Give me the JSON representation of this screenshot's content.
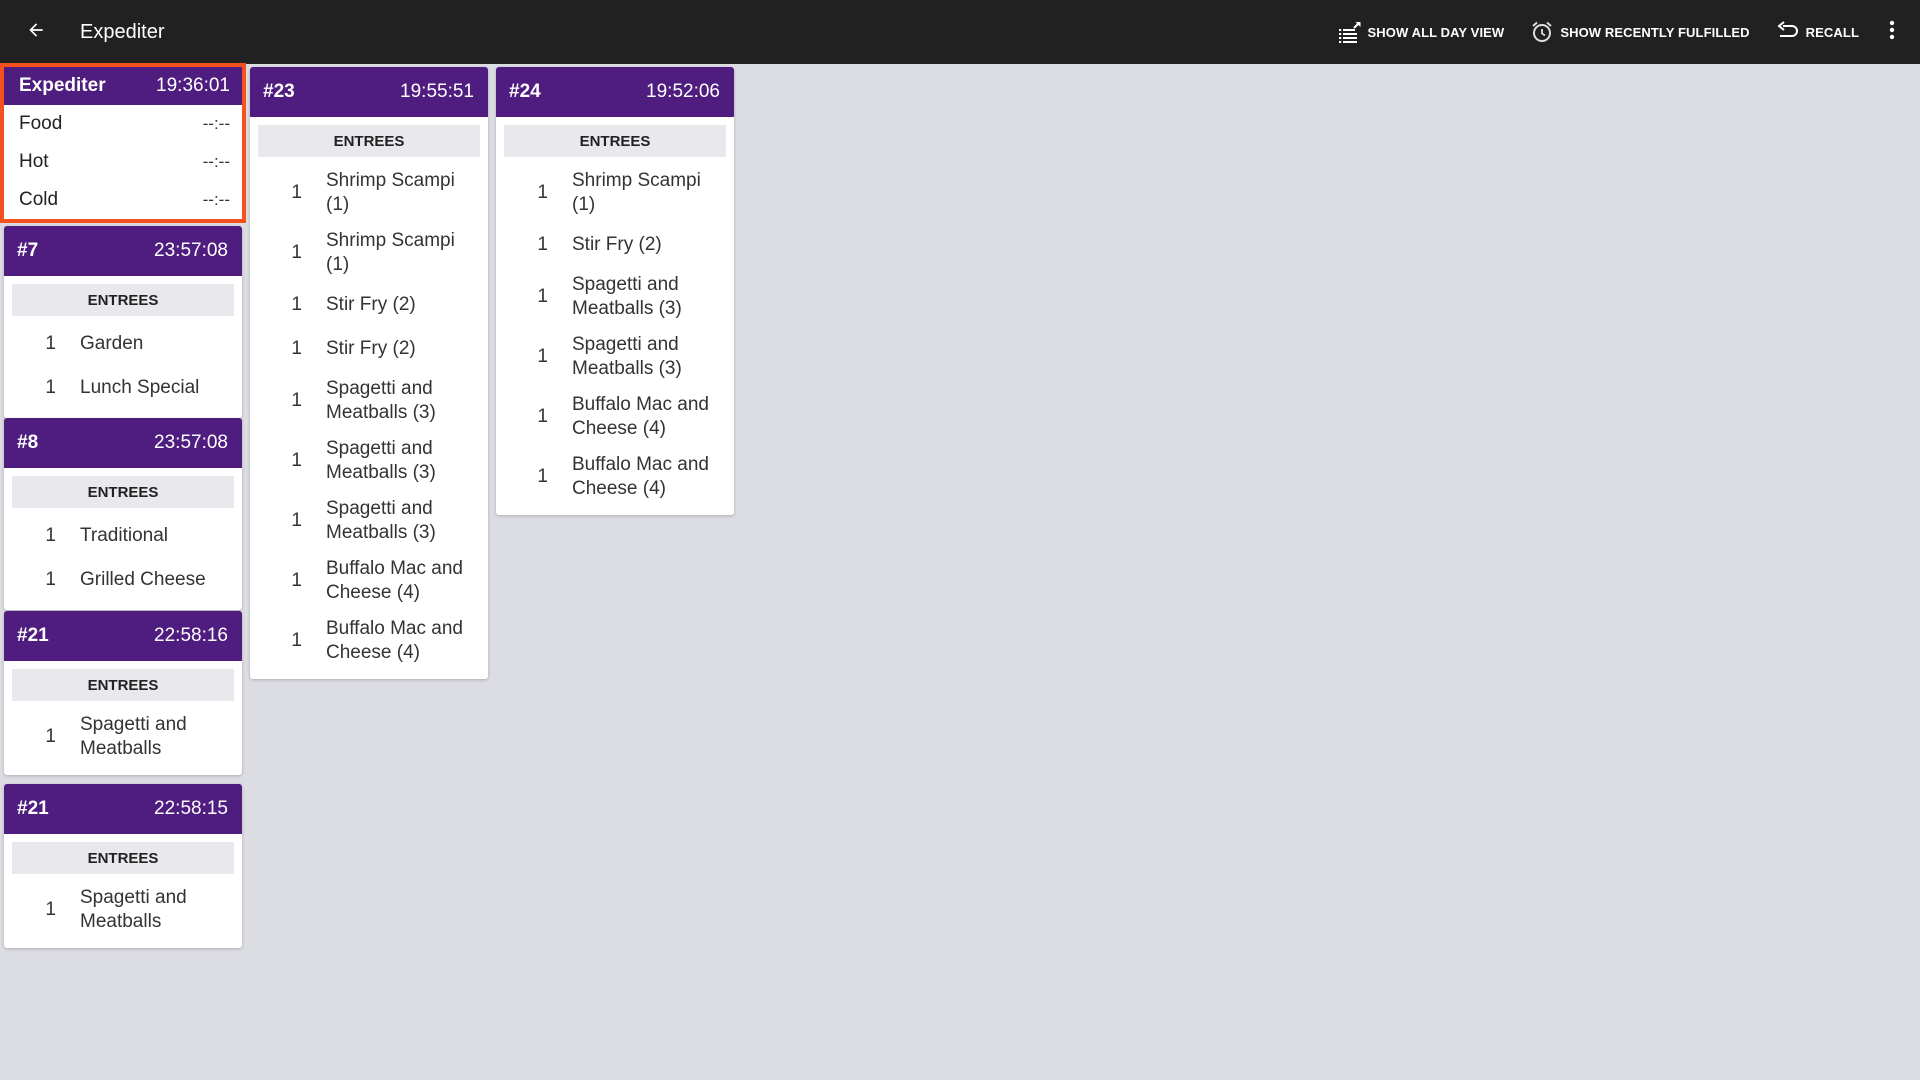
{
  "header": {
    "title": "Expediter",
    "actions": [
      {
        "label": "SHOW ALL DAY VIEW",
        "icon": "list-expand-icon"
      },
      {
        "label": "SHOW RECENTLY FULFILLED",
        "icon": "alarm-clock-icon"
      },
      {
        "label": "RECALL",
        "icon": "undo-icon"
      }
    ],
    "more_icon": "more-vert-icon",
    "back_icon": "arrow-back-icon"
  },
  "colors": {
    "topbar": "#212121",
    "card_header": "#4f1c7f",
    "selected_border": "#f4511e",
    "background": "#dcdde2",
    "section_bg": "#e8e8ed"
  },
  "expediter": {
    "title": "Expediter",
    "time": "19:36:01",
    "rows": [
      {
        "label": "Food",
        "value": "--:--"
      },
      {
        "label": "Hot",
        "value": "--:--"
      },
      {
        "label": "Cold",
        "value": "--:--"
      }
    ]
  },
  "orders": [
    {
      "number": "#7",
      "time": "23:57:08",
      "section": "ENTREES",
      "items": [
        {
          "qty": "1",
          "name": "Garden"
        },
        {
          "qty": "1",
          "name": "Lunch Special"
        }
      ]
    },
    {
      "number": "#8",
      "time": "23:57:08",
      "section": "ENTREES",
      "items": [
        {
          "qty": "1",
          "name": "Traditional"
        },
        {
          "qty": "1",
          "name": "Grilled Cheese"
        }
      ]
    },
    {
      "number": "#21",
      "time": "22:58:16",
      "section": "ENTREES",
      "items": [
        {
          "qty": "1",
          "name": "Spagetti and Meatballs"
        }
      ]
    },
    {
      "number": "#21",
      "time": "22:58:15",
      "section": "ENTREES",
      "items": [
        {
          "qty": "1",
          "name": "Spagetti and Meatballs"
        }
      ]
    },
    {
      "number": "#23",
      "time": "19:55:51",
      "section": "ENTREES",
      "items": [
        {
          "qty": "1",
          "name": "Shrimp Scampi (1)"
        },
        {
          "qty": "1",
          "name": "Shrimp Scampi (1)"
        },
        {
          "qty": "1",
          "name": "Stir Fry (2)"
        },
        {
          "qty": "1",
          "name": "Stir Fry (2)"
        },
        {
          "qty": "1",
          "name": "Spagetti and Meatballs (3)"
        },
        {
          "qty": "1",
          "name": "Spagetti and Meatballs (3)"
        },
        {
          "qty": "1",
          "name": "Spagetti and Meatballs (3)"
        },
        {
          "qty": "1",
          "name": "Buffalo Mac and Cheese (4)"
        },
        {
          "qty": "1",
          "name": "Buffalo Mac and Cheese (4)"
        }
      ]
    },
    {
      "number": "#24",
      "time": "19:52:06",
      "section": "ENTREES",
      "items": [
        {
          "qty": "1",
          "name": "Shrimp Scampi (1)"
        },
        {
          "qty": "1",
          "name": "Stir Fry (2)"
        },
        {
          "qty": "1",
          "name": "Spagetti and Meatballs (3)"
        },
        {
          "qty": "1",
          "name": "Spagetti and Meatballs (3)"
        },
        {
          "qty": "1",
          "name": "Buffalo Mac and Cheese (4)"
        },
        {
          "qty": "1",
          "name": "Buffalo Mac and Cheese (4)"
        }
      ]
    }
  ]
}
